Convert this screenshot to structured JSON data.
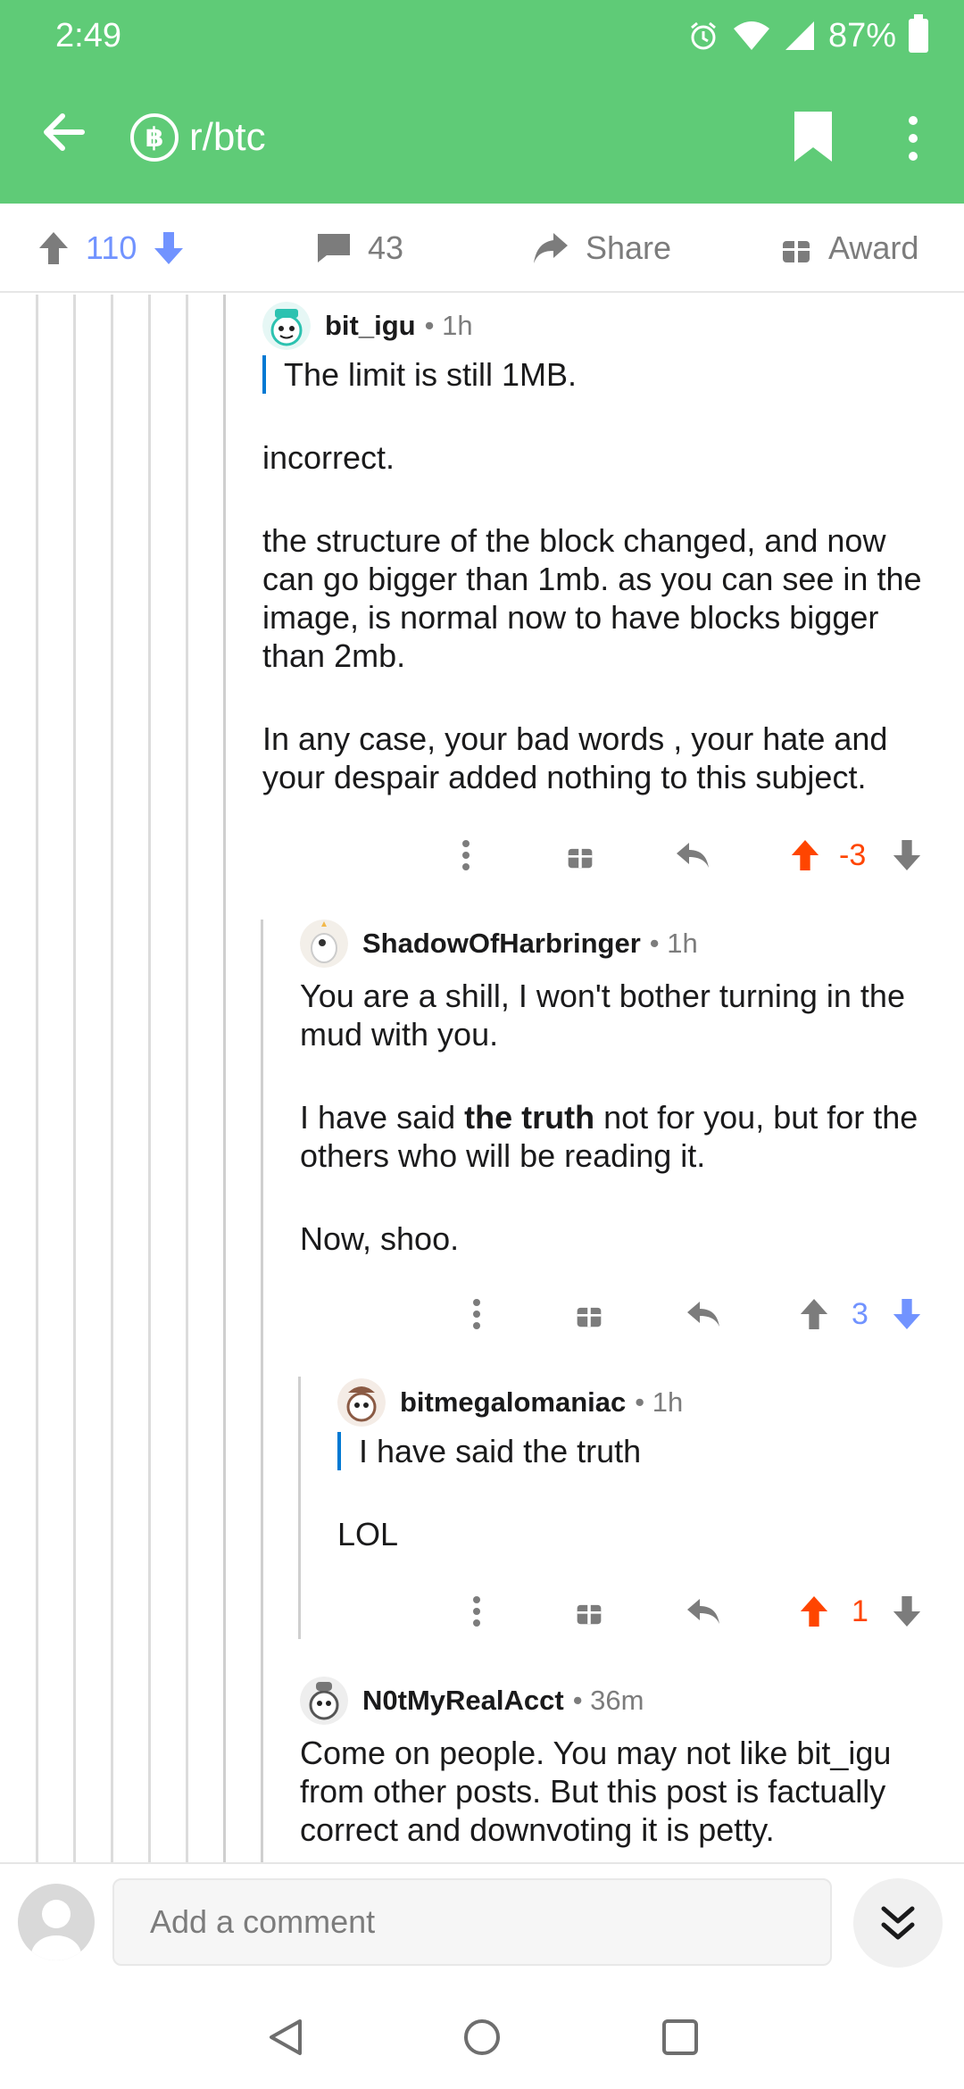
{
  "status": {
    "time": "2:49",
    "battery": "87%"
  },
  "header": {
    "subreddit": "r/btc",
    "subreddit_icon": "฿"
  },
  "actions": {
    "upvotes": "110",
    "comments": "43",
    "share_label": "Share",
    "award_label": "Award"
  },
  "comments": [
    {
      "user": "bit_igu",
      "time": "1h",
      "quote": "The limit is still 1MB.",
      "paragraphs": [
        "incorrect.",
        "the structure of the block changed, and now can go bigger than 1mb. as you can see in the image, is normal now to have blocks bigger than 2mb.",
        "In any case, your bad words , your hate and your despair added nothing to this subject."
      ],
      "score": "-3",
      "vote_state": "upvoted"
    },
    {
      "user": "ShadowOfHarbringer",
      "time": "1h",
      "p1": "You are a shill, I won't bother turning in the mud with you.",
      "p2_pre": "I have said ",
      "p2_bold": "the truth",
      "p2_post": " not for you, but for the others who will be reading it.",
      "p3": "Now, shoo.",
      "score": "3",
      "vote_state": "downvoted"
    },
    {
      "user": "bitmegalomaniac",
      "time": "1h",
      "quote": "I have said the truth",
      "p1": "LOL",
      "score": "1",
      "vote_state": "upvoted"
    },
    {
      "user": "N0tMyRealAcct",
      "time": "36m",
      "p1": "Come on people. You may not like bit_igu from other posts. But this post is factually correct and downvoting it is petty."
    }
  ],
  "composer": {
    "placeholder": "Add a comment"
  },
  "colors": {
    "brand": "#5fcb77",
    "upvote": "#ff4500",
    "downvote": "#7193ff",
    "quote_bar": "#0079d3"
  }
}
